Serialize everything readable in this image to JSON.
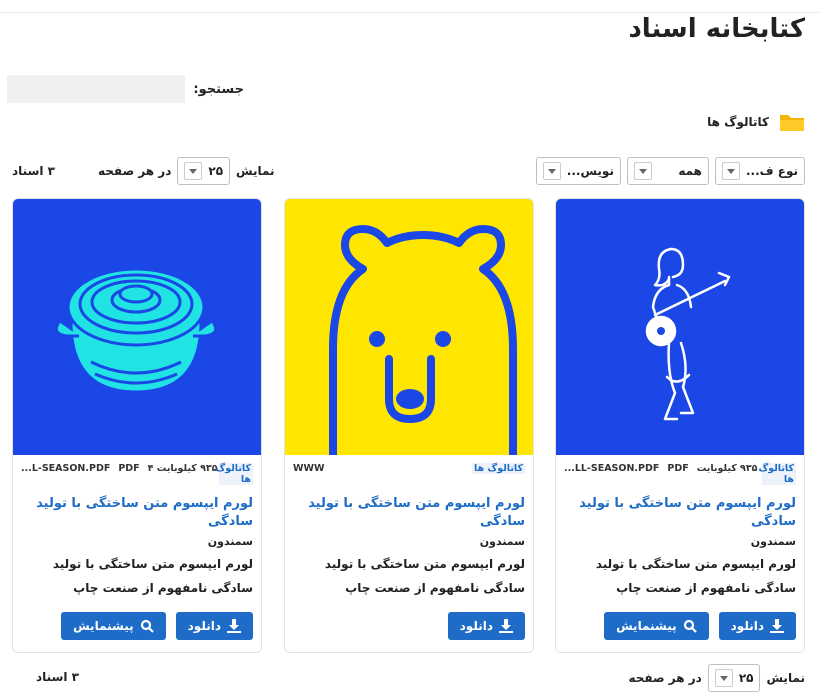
{
  "page": {
    "title": "کتابخانه اسناد"
  },
  "search": {
    "label": "جستجو:",
    "value": "",
    "placeholder": ""
  },
  "breadcrumb": {
    "label": "کاتالوگ ها",
    "icon": "folder-icon",
    "color": "#f4b400"
  },
  "filters": [
    {
      "label": "نوع ف..."
    },
    {
      "label": "همه"
    },
    {
      "label": "نویس..."
    }
  ],
  "pagination": {
    "show_label": "نمایش",
    "per_page_value": "۲۵",
    "per_page_suffix": "در هر صفحه",
    "count_text": "۳ اسناد"
  },
  "cards": [
    {
      "thumb_color": "#1a47e6",
      "thumb_icon": "guitar-player-icon",
      "filename": "...LL-SEASON.PDF",
      "type": "PDF",
      "size": "۹۳۵ کیلوبایت",
      "tag": "کاتالوگ ها",
      "title": "لورم ایپسوم متن ساختگی با تولید سادگی",
      "author": "سمندون",
      "description": "لورم ایپسوم متن ساختگی با تولید سادگی نامفهوم از صنعت چاپ",
      "download_label": "دانلود",
      "preview_label": "پیشنمایش"
    },
    {
      "thumb_color": "#ffe600",
      "thumb_icon": "bear-icon",
      "filename": "WWW",
      "tag": "کاتالوگ ها",
      "title": "لورم ایپسوم متن ساختگی با تولید سادگی",
      "author": "سمندون",
      "description": "لورم ایپسوم متن ساختگی با تولید سادگی نامفهوم از صنعت چاپ",
      "download_label": "دانلود"
    },
    {
      "thumb_color": "#1a47e6",
      "thumb_icon": "pot-icon",
      "filename": "...L-SEASON.PDF",
      "type": "PDF",
      "size": "۹۳۵ کیلوبایت ۴",
      "tag": "کاتالوگ ها",
      "title": "لورم ایپسوم متن ساختگی با تولید سادگی",
      "author": "سمندون",
      "description": "لورم ایپسوم متن ساختگی با تولید سادگی نامفهوم از صنعت چاپ",
      "download_label": "دانلود",
      "preview_label": "پیشنمایش"
    }
  ],
  "colors": {
    "accent": "#1e6cc7",
    "thumb_blue": "#1a47e6",
    "thumb_yellow": "#ffe600",
    "pot_cyan": "#22e3e3"
  }
}
